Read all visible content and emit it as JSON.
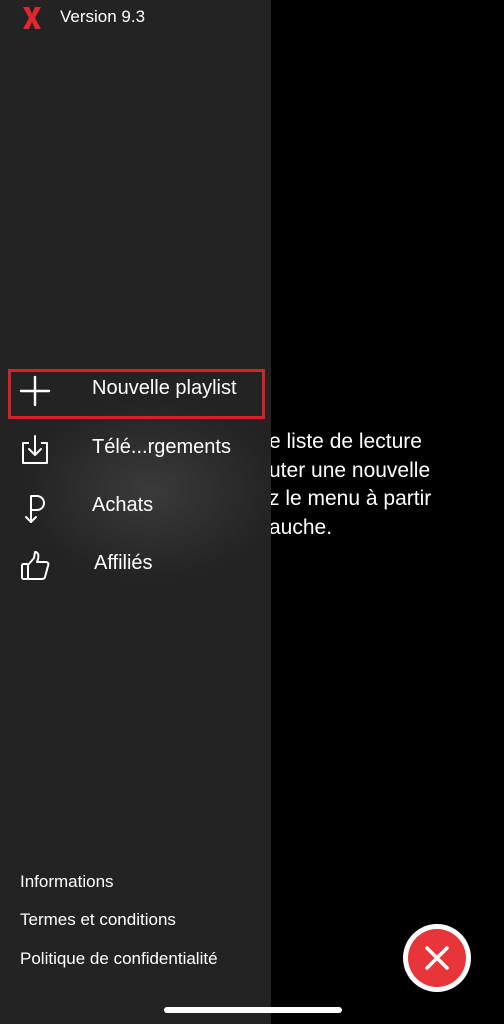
{
  "app": {
    "version": "Version 9.3",
    "logo_icon": "x-logo-icon",
    "accent": "#d81f2a"
  },
  "menu": [
    {
      "label": "Nouvelle playlist",
      "icon": "plus-icon"
    },
    {
      "label": "Télé...rgements",
      "icon": "download-icon"
    },
    {
      "label": "Achats",
      "icon": "purchases-icon"
    },
    {
      "label": "Affiliés",
      "icon": "thumbs-up-icon"
    }
  ],
  "footer": [
    "Informations",
    "Termes et conditions",
    "Politique de confidentialité"
  ],
  "main": {
    "message_lines": [
      "e liste de lecture",
      "uter une nouvelle",
      "z le menu à partir",
      "auche."
    ]
  }
}
